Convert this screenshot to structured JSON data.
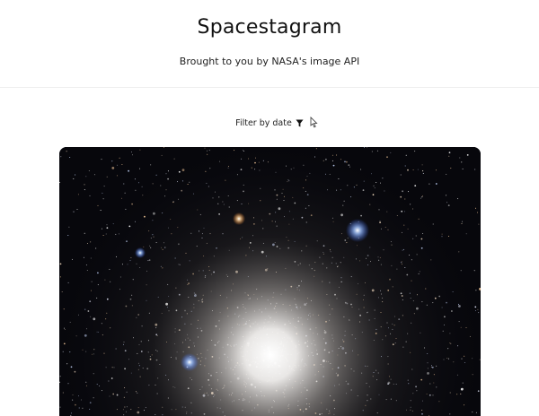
{
  "header": {
    "title": "Spacestagram",
    "subtitle": "Brought to you by NASA's image API"
  },
  "filter": {
    "label": "Filter by date",
    "icon": "filter-funnel-icon"
  },
  "post": {
    "image": "star-cluster-photo"
  },
  "colors": {
    "background": "#ffffff",
    "text": "#111111",
    "divider": "#eeeeee",
    "space": "#0a0a10"
  }
}
